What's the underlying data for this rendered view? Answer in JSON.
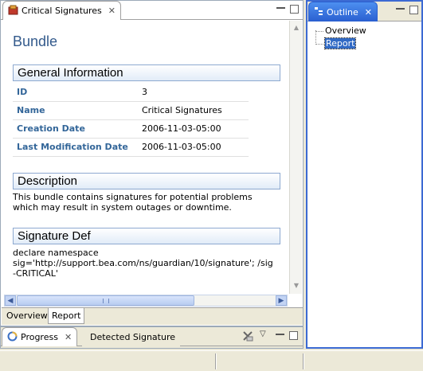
{
  "editor": {
    "tab_title": "Critical Signatures",
    "page_title": "Bundle",
    "general_info": {
      "heading": "General Information",
      "rows": [
        {
          "label": "ID",
          "value": "3"
        },
        {
          "label": "Name",
          "value": "Critical Signatures"
        },
        {
          "label": "Creation Date",
          "value": "2006-11-03-05:00"
        },
        {
          "label": "Last Modification Date",
          "value": "2006-11-03-05:00"
        }
      ]
    },
    "description": {
      "heading": "Description",
      "line1": "This bundle contains signatures for potential problems",
      "line2": "which may result in system outages or downtime."
    },
    "signature_def": {
      "heading": "Signature Def",
      "line1": "declare namespace",
      "line2": "sig='http://support.bea.com/ns/guardian/10/signature'; /sig",
      "line3": "-CRITICAL'"
    },
    "page_tabs": [
      "Overview",
      "Report"
    ]
  },
  "outline": {
    "tab_title": "Outline",
    "items": [
      "Overview",
      "Report"
    ]
  },
  "bottom_view": {
    "tabs": [
      "Progress",
      "Detected Signature"
    ]
  },
  "colors": {
    "accent": "#335a8c",
    "selection": "#316ac5",
    "section_border": "#8da9d0"
  }
}
